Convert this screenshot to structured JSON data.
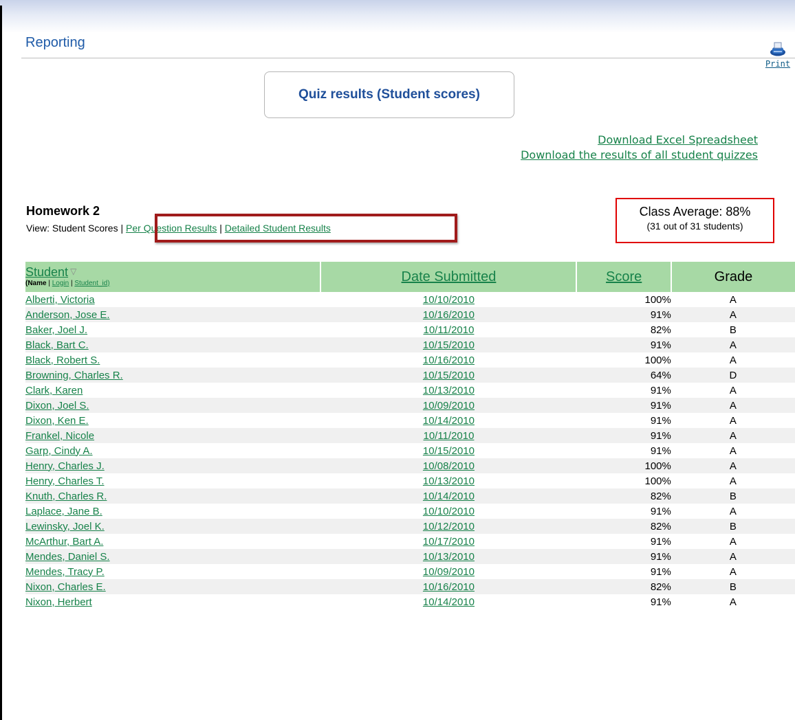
{
  "header": {
    "title": "Reporting",
    "print_label": "Print"
  },
  "report": {
    "heading": "Quiz results (Student scores)",
    "download_excel": "Download Excel Spreadsheet",
    "download_all": "Download the results of all student quizzes",
    "quiz_name": "Homework 2",
    "view_label": "View: Student Scores",
    "separator": "|",
    "per_question": "Per Question Results",
    "detailed": "Detailed Student Results",
    "class_average": "Class Average: 88%",
    "students_count": "(31 out of 31 students)"
  },
  "table": {
    "headers": {
      "student": "Student",
      "student_sub_name": "(Name",
      "student_sub_login": "Login",
      "student_sub_id": "Student_id)",
      "date": "Date Submitted",
      "score": "Score",
      "grade": "Grade"
    },
    "rows": [
      {
        "name": "Alberti, Victoria",
        "date": "10/10/2010",
        "score": "100%",
        "grade": "A"
      },
      {
        "name": "Anderson, Jose E.",
        "date": "10/16/2010",
        "score": "91%",
        "grade": "A"
      },
      {
        "name": "Baker, Joel J.",
        "date": "10/11/2010",
        "score": "82%",
        "grade": "B"
      },
      {
        "name": "Black, Bart C.",
        "date": "10/15/2010",
        "score": "91%",
        "grade": "A"
      },
      {
        "name": "Black, Robert S.",
        "date": "10/16/2010",
        "score": "100%",
        "grade": "A"
      },
      {
        "name": "Browning, Charles R.",
        "date": "10/15/2010",
        "score": "64%",
        "grade": "D"
      },
      {
        "name": "Clark, Karen",
        "date": "10/13/2010",
        "score": "91%",
        "grade": "A"
      },
      {
        "name": "Dixon, Joel S.",
        "date": "10/09/2010",
        "score": "91%",
        "grade": "A"
      },
      {
        "name": "Dixon, Ken E.",
        "date": "10/14/2010",
        "score": "91%",
        "grade": "A"
      },
      {
        "name": "Frankel, Nicole",
        "date": "10/11/2010",
        "score": "91%",
        "grade": "A"
      },
      {
        "name": "Garp, Cindy A.",
        "date": "10/15/2010",
        "score": "91%",
        "grade": "A"
      },
      {
        "name": "Henry, Charles J.",
        "date": "10/08/2010",
        "score": "100%",
        "grade": "A"
      },
      {
        "name": "Henry, Charles T.",
        "date": "10/13/2010",
        "score": "100%",
        "grade": "A"
      },
      {
        "name": "Knuth, Charles R.",
        "date": "10/14/2010",
        "score": "82%",
        "grade": "B"
      },
      {
        "name": "Laplace, Jane B.",
        "date": "10/10/2010",
        "score": "91%",
        "grade": "A"
      },
      {
        "name": "Lewinsky, Joel K.",
        "date": "10/12/2010",
        "score": "82%",
        "grade": "B"
      },
      {
        "name": "McArthur, Bart A.",
        "date": "10/17/2010",
        "score": "91%",
        "grade": "A"
      },
      {
        "name": "Mendes, Daniel S.",
        "date": "10/13/2010",
        "score": "91%",
        "grade": "A"
      },
      {
        "name": "Mendes, Tracy P.",
        "date": "10/09/2010",
        "score": "91%",
        "grade": "A"
      },
      {
        "name": "Nixon, Charles E.",
        "date": "10/16/2010",
        "score": "82%",
        "grade": "B"
      },
      {
        "name": "Nixon, Herbert",
        "date": "10/14/2010",
        "score": "91%",
        "grade": "A"
      }
    ]
  },
  "colors": {
    "title_blue": "#1f5ba8",
    "link_green": "#17824a",
    "header_green": "#a7d9a5",
    "highlight_red": "#e00000",
    "highlight_dark_red": "#a01b1b"
  },
  "icons": {
    "print": "printer-icon",
    "sort": "sort-descending-icon"
  }
}
